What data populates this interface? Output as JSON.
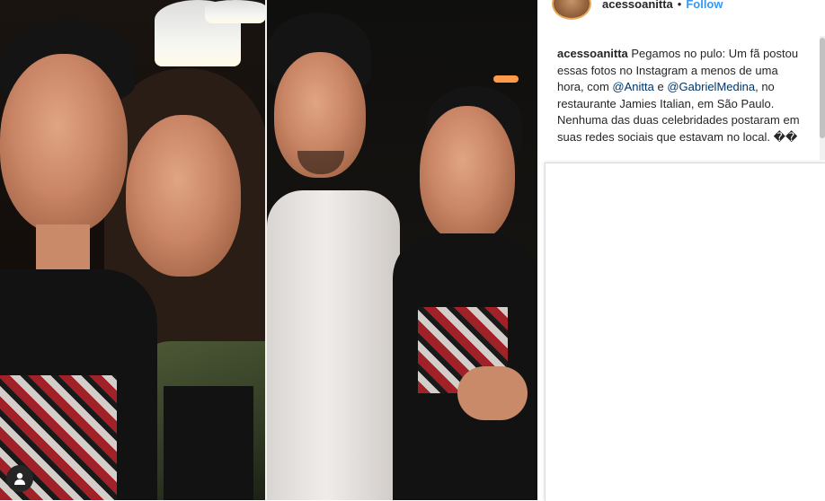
{
  "post": {
    "username": "acessoanitta",
    "follow_label": "Follow",
    "separator": "•"
  },
  "caption": {
    "username": "acessoanitta",
    "text_1": "Pegamos no pulo: Um fã postou essas fotos no Instagram a menos de uma hora, com ",
    "mention_1": "@Anitta",
    "text_2": " e ",
    "mention_2": "@GabrielMedina",
    "text_3": ", no restaurante Jamies Italian, em São Paulo. Nenhuma das duas celebridades postaram em suas redes sociais que estavam no local. ��"
  },
  "icons": {
    "profile_tag": "user-tag-icon",
    "avatar": "profile-avatar"
  },
  "colors": {
    "follow": "#3897f0",
    "mention": "#003569",
    "text": "#262626",
    "avatar_ring": "#e8a85a"
  }
}
